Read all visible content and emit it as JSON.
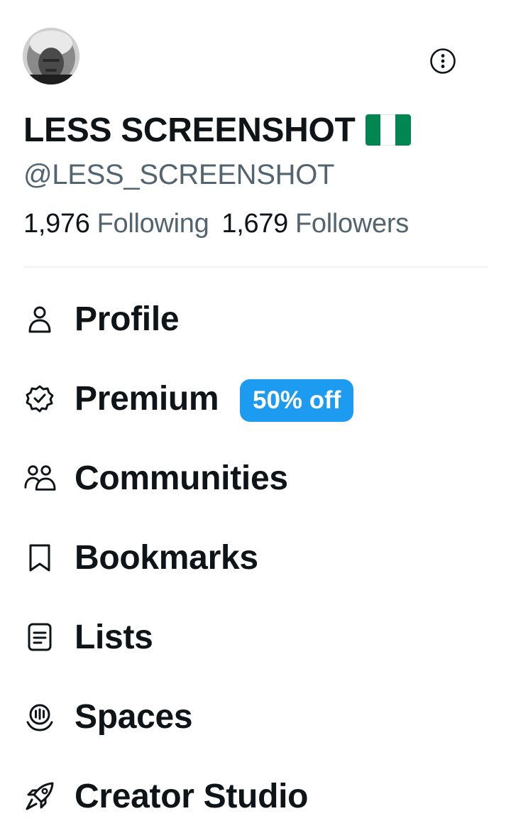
{
  "profile": {
    "display_name": "LESS SCREENSHOT",
    "handle": "@LESS_SCREENSHOT",
    "flag_icon": "nigeria-flag-icon",
    "flag_colors": [
      "#008751",
      "#ffffff",
      "#008751"
    ]
  },
  "stats": {
    "following_count": "1,976",
    "following_label": "Following",
    "followers_count": "1,679",
    "followers_label": "Followers"
  },
  "menu": {
    "items": [
      {
        "label": "Profile",
        "icon": "person-icon"
      },
      {
        "label": "Premium",
        "icon": "verified-badge-icon",
        "badge": "50% off"
      },
      {
        "label": "Communities",
        "icon": "communities-icon"
      },
      {
        "label": "Bookmarks",
        "icon": "bookmark-icon"
      },
      {
        "label": "Lists",
        "icon": "list-icon"
      },
      {
        "label": "Spaces",
        "icon": "spaces-icon"
      },
      {
        "label": "Creator Studio",
        "icon": "rocket-icon"
      }
    ]
  },
  "colors": {
    "text_primary": "#0f1419",
    "text_secondary": "#536471",
    "accent": "#1d9bf0",
    "divider": "#eff3f4"
  }
}
